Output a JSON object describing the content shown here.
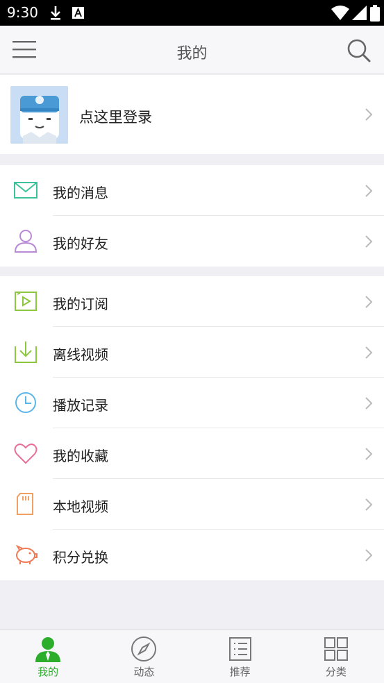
{
  "status_bar": {
    "time": "9:30"
  },
  "header": {
    "title": "我的"
  },
  "login": {
    "text": "点这里登录"
  },
  "groups": [
    {
      "items": [
        {
          "label": "我的消息",
          "icon": "mail-icon",
          "color": "#3cc29a"
        },
        {
          "label": "我的好友",
          "icon": "person-icon",
          "color": "#b98ad6"
        }
      ]
    },
    {
      "items": [
        {
          "label": "我的订阅",
          "icon": "subscribe-icon",
          "color": "#8dc63f"
        },
        {
          "label": "离线视频",
          "icon": "download-icon",
          "color": "#8dc63f"
        },
        {
          "label": "播放记录",
          "icon": "clock-icon",
          "color": "#5bb6e8"
        },
        {
          "label": "我的收藏",
          "icon": "heart-icon",
          "color": "#e86f9a"
        },
        {
          "label": "本地视频",
          "icon": "sdcard-icon",
          "color": "#f0a062"
        },
        {
          "label": "积分兑换",
          "icon": "piggy-bank-icon",
          "color": "#f07a55"
        }
      ]
    }
  ],
  "tabs": [
    {
      "label": "我的",
      "icon": "user-icon",
      "active": true
    },
    {
      "label": "动态",
      "icon": "compass-icon",
      "active": false
    },
    {
      "label": "推荐",
      "icon": "list-icon",
      "active": false
    },
    {
      "label": "分类",
      "icon": "grid-icon",
      "active": false
    }
  ],
  "colors": {
    "accent": "#2cae2c",
    "background": "#efeff4"
  }
}
